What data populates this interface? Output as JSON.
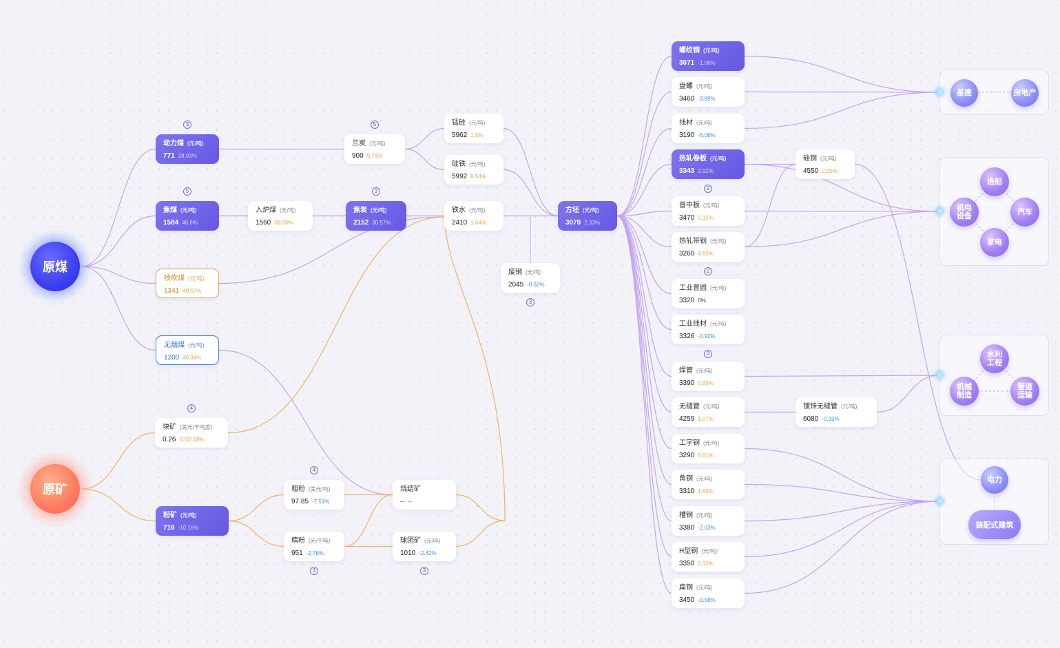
{
  "sources": {
    "coal": {
      "label": "原煤"
    },
    "ore": {
      "label": "原矿"
    }
  },
  "nodes": {
    "donglimei": {
      "name": "动力煤",
      "unit": "(元/吨)",
      "price": "771",
      "change": "28.93%",
      "trend": "up"
    },
    "jiaomei": {
      "name": "焦煤",
      "unit": "(元/吨)",
      "price": "1584",
      "change": "46.6%",
      "trend": "up"
    },
    "penchuimei": {
      "name": "喷吹煤",
      "unit": "(元/吨)",
      "price": "1341",
      "change": "40.57%",
      "trend": "up"
    },
    "wuyanmei": {
      "name": "无烟煤",
      "unit": "(元/吨)",
      "price": "1200",
      "change": "46.34%",
      "trend": "up"
    },
    "ruluomei": {
      "name": "入炉煤",
      "unit": "(元/吨)",
      "price": "1560",
      "change": "38.05%",
      "trend": "up"
    },
    "lantan": {
      "name": "兰炭",
      "unit": "(元/吨)",
      "price": "900",
      "change": "9.76%",
      "trend": "up"
    },
    "jiaotan": {
      "name": "焦炭",
      "unit": "(元/吨)",
      "price": "2152",
      "change": "30.57%",
      "trend": "up"
    },
    "mengui": {
      "name": "锰硅",
      "unit": "(元/吨)",
      "price": "5962",
      "change": "1.5%",
      "trend": "up"
    },
    "guitie": {
      "name": "硅铁",
      "unit": "(元/吨)",
      "price": "5992",
      "change": "6.54%",
      "trend": "up"
    },
    "tieshui": {
      "name": "铁水",
      "unit": "(元/吨)",
      "price": "2410",
      "change": "1.64%",
      "trend": "up"
    },
    "feigang": {
      "name": "废钢",
      "unit": "(元/吨)",
      "price": "2045",
      "change": "-0.63%",
      "trend": "down"
    },
    "fangpi": {
      "name": "方坯",
      "unit": "(元/吨)",
      "price": "3070",
      "change": "2.33%",
      "trend": "up"
    },
    "kuaikuang": {
      "name": "块矿",
      "unit": "(美元/干吨度)",
      "price": "0.26",
      "change": "1002.08%",
      "trend": "up"
    },
    "fenkuang": {
      "name": "粉矿",
      "unit": "(元/吨)",
      "price": "716",
      "change": "-10.16%",
      "trend": "down"
    },
    "cufen": {
      "name": "粗粉",
      "unit": "(美元/吨)",
      "price": "97.85",
      "change": "-7.51%",
      "trend": "down"
    },
    "jingfen": {
      "name": "精粉",
      "unit": "(元/干吨)",
      "price": "951",
      "change": "-2.76%",
      "trend": "down"
    },
    "shaojiekuang": {
      "name": "烧结矿",
      "unit": "",
      "price": "--",
      "change": "--",
      "trend": "flat"
    },
    "qiutuankuang": {
      "name": "球团矿",
      "unit": "(元/吨)",
      "price": "1010",
      "change": "-2.42%",
      "trend": "down"
    },
    "luowengang": {
      "name": "螺纹钢",
      "unit": "(元/吨)",
      "price": "3071",
      "change": "-1.06%",
      "trend": "down"
    },
    "panluo": {
      "name": "盘螺",
      "unit": "(元/吨)",
      "price": "3460",
      "change": "-3.89%",
      "trend": "down"
    },
    "xiancai": {
      "name": "线材",
      "unit": "(元/吨)",
      "price": "3190",
      "change": "-5.06%",
      "trend": "down"
    },
    "rezhajuanban": {
      "name": "热轧卷板",
      "unit": "(元/吨)",
      "price": "3343",
      "change": "2.92%",
      "trend": "up"
    },
    "puzhongban": {
      "name": "普中板",
      "unit": "(元/吨)",
      "price": "3470",
      "change": "5.15%",
      "trend": "up"
    },
    "rezhadaigang": {
      "name": "热轧带钢",
      "unit": "(元/吨)",
      "price": "3260",
      "change": "4.82%",
      "trend": "up"
    },
    "gongyepuyuan": {
      "name": "工业普圆",
      "unit": "(元/吨)",
      "price": "3320",
      "change": "0%",
      "trend": "flat"
    },
    "gongyexiancai": {
      "name": "工业线材",
      "unit": "(元/吨)",
      "price": "3326",
      "change": "-0.92%",
      "trend": "down"
    },
    "hanguan": {
      "name": "焊管",
      "unit": "(元/吨)",
      "price": "3390",
      "change": "0.89%",
      "trend": "up"
    },
    "wufengguan": {
      "name": "无缝管",
      "unit": "(元/吨)",
      "price": "4259",
      "change": "1.07%",
      "trend": "up"
    },
    "gongzigang": {
      "name": "工字钢",
      "unit": "(元/吨)",
      "price": "3290",
      "change": "0.61%",
      "trend": "up"
    },
    "jiaogang": {
      "name": "角钢",
      "unit": "(元/吨)",
      "price": "3310",
      "change": "1.85%",
      "trend": "up"
    },
    "caogang": {
      "name": "槽钢",
      "unit": "(元/吨)",
      "price": "3380",
      "change": "-2.03%",
      "trend": "down"
    },
    "hxinggang": {
      "name": "H型钢",
      "unit": "(元/吨)",
      "price": "3350",
      "change": "2.13%",
      "trend": "up"
    },
    "biangang": {
      "name": "扁钢",
      "unit": "(元/吨)",
      "price": "3450",
      "change": "-0.58%",
      "trend": "down"
    },
    "guigang": {
      "name": "硅钢",
      "unit": "(元/吨)",
      "price": "4550",
      "change": "2.25%",
      "trend": "up"
    },
    "duxinwufengguan": {
      "name": "镀锌无缝管",
      "unit": "(元/吨)",
      "price": "6080",
      "change": "-0.33%",
      "trend": "down"
    }
  },
  "badges": {
    "donglimei": "3",
    "jiaomei": "5",
    "lantan": "5",
    "jiaotan": "3",
    "feigang": "3",
    "rezhajuanban": "2",
    "rezhadaigang": "2",
    "gongyexiancai": "3",
    "kuaikuang": "4",
    "cufen": "4",
    "jingfen": "3",
    "qiutuankuang": "3"
  },
  "industries": {
    "jijian": "基建",
    "fangdichan": "房地产",
    "zaochuan": "造船",
    "jidian": "机电\n设备",
    "qiche": "汽车",
    "jiadian": "家电",
    "shuili": "水利\n工程",
    "jixie": "机械\n制造",
    "guandao": "管道\n运输",
    "dianli": "电力",
    "zhuangpei": "装配式建筑"
  },
  "colors": {
    "accent": "#6f63e8",
    "purple_line": "#c3a5ef",
    "orange_line": "#f2b260",
    "up": "#f0a24c",
    "down": "#3d8ff0"
  }
}
